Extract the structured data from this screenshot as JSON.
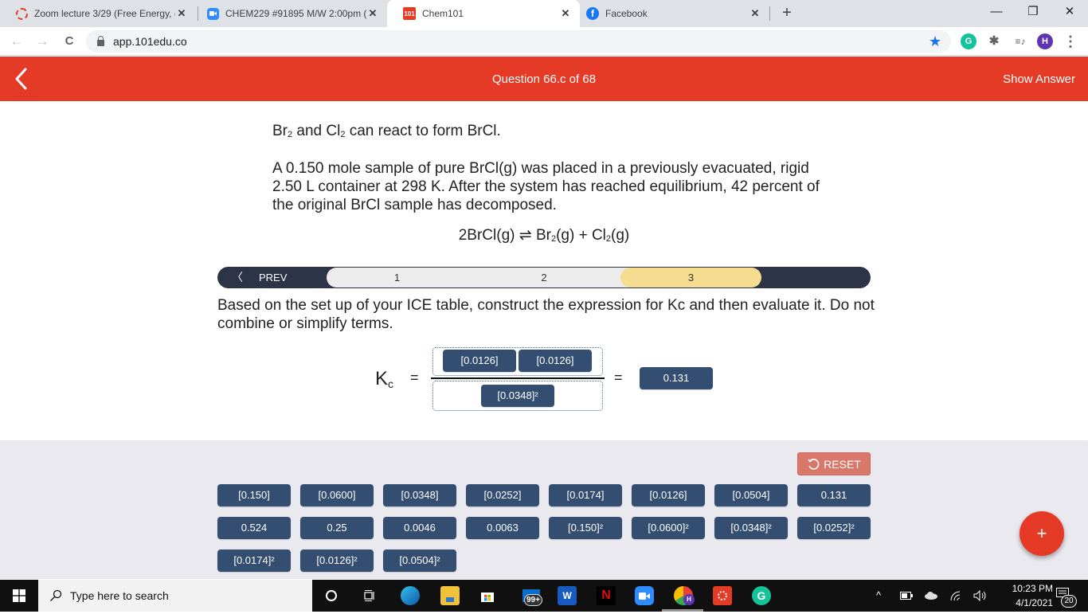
{
  "browser": {
    "tabs": [
      {
        "title": "Zoom lecture 3/29 (Free Energy, (",
        "icon": "zoom-circle-icon",
        "active": false
      },
      {
        "title": "CHEM229 #91895 M/W 2:00pm (",
        "icon": "zoom-video-icon",
        "active": false
      },
      {
        "title": "Chem101",
        "icon": "101-logo-icon",
        "icon_text": "101",
        "active": true
      },
      {
        "title": "Facebook",
        "icon": "facebook-icon",
        "icon_text": "f",
        "active": false
      }
    ],
    "close_glyph": "✕",
    "new_tab_glyph": "+",
    "window_controls": {
      "minimize": "—",
      "restore": "❐",
      "close": "✕"
    },
    "nav": {
      "back": "←",
      "forward": "→",
      "reload": "C"
    },
    "url": "app.101edu.co",
    "extensions": [
      {
        "name": "grammarly",
        "text": "G",
        "color": "#15c39a"
      },
      {
        "name": "puzzle",
        "text": "✱",
        "color": "#5f6368"
      },
      {
        "name": "media",
        "text": "≡♪",
        "color": "#5f6368"
      },
      {
        "name": "profile",
        "text": "H",
        "color": "#5e35b1"
      },
      {
        "name": "menu",
        "text": "⋮",
        "color": "#5f6368"
      }
    ]
  },
  "app": {
    "accent": "#e53b26",
    "question_title": "Question 66.c of 68",
    "show_answer": "Show Answer",
    "intro": {
      "a": "Br",
      "a_sub": "2",
      "b": " and Cl",
      "b_sub": "2",
      "c": " can react to form BrCl."
    },
    "paragraph": "A 0.150 mole sample of pure BrCl(g) was placed in a previously evacuated, rigid 2.50 L container at 298 K. After the system has reached equilibrium, 42 percent of the original BrCl sample has decomposed.",
    "equation": {
      "lhs": "2BrCl(g) ⇌ Br",
      "sub1": "2",
      "mid": "(g) + Cl",
      "sub2": "2",
      "end": "(g)"
    },
    "stepper": {
      "prev_label": "PREV",
      "prev_glyph": "〈",
      "steps": [
        "1",
        "2",
        "3"
      ],
      "active_step": "3"
    },
    "instructions": "Based on the set up of your ICE table, construct the expression for Kc and then evaluate it. Do not combine or simplify terms.",
    "kc_expression": {
      "label": "K",
      "label_sub": "c",
      "equals": "=",
      "numerator": [
        "[0.0126]",
        "[0.0126]"
      ],
      "denominator": [
        "[0.0348]²"
      ],
      "result": "0.131"
    },
    "bank": {
      "reset_label": "RESET",
      "rows": [
        [
          "[0.150]",
          "[0.0600]",
          "[0.0348]",
          "[0.0252]",
          "[0.0174]",
          "[0.0126]",
          "[0.0504]",
          "0.131"
        ],
        [
          "0.524",
          "0.25",
          "0.0046",
          "0.0063",
          "[0.150]²",
          "[0.0600]²",
          "[0.0348]²",
          "[0.0252]²"
        ],
        [
          "[0.0174]²",
          "[0.0126]²",
          "[0.0504]²"
        ]
      ],
      "fab_label": "+"
    }
  },
  "taskbar": {
    "search_placeholder": "Type here to search",
    "mail_badge": "99+",
    "time": "10:23 PM",
    "date": "4/1/2021",
    "notification_count": "20",
    "tray_chevron": "^"
  }
}
